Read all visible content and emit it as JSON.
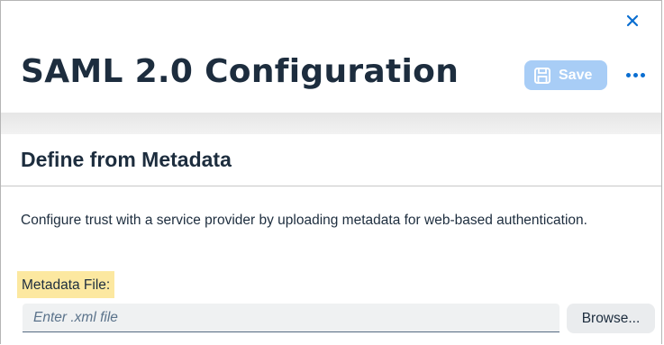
{
  "dialog": {
    "title": "SAML 2.0 Configuration",
    "close_icon": "close-icon",
    "save_label": "Save",
    "save_icon": "save-icon",
    "more_icon": "overflow-menu-icon"
  },
  "section": {
    "title": "Define from Metadata",
    "description": "Configure trust with a service provider by uploading metadata for web-based authentication."
  },
  "metadata_file": {
    "label": "Metadata File:",
    "value": "",
    "placeholder": "Enter .xml file",
    "browse_label": "Browse..."
  },
  "colors": {
    "accent": "#0a6ed1",
    "save_button_bg": "#a8cdf6",
    "label_highlight": "#fce8a0",
    "text": "#1d2d3e"
  }
}
